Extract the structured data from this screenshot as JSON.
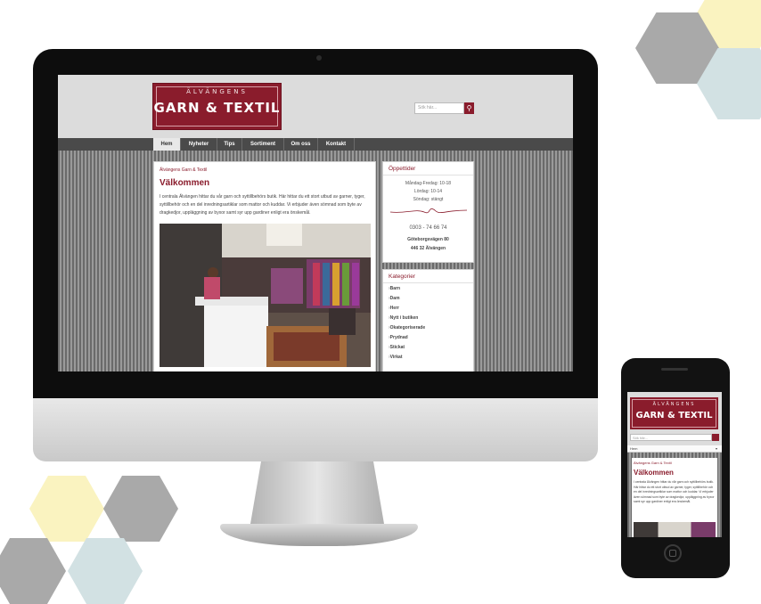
{
  "colors": {
    "brand": "#8a1c2c",
    "hex_yellow": "#faf3c0",
    "hex_blue": "#d2e1e3",
    "hex_gray": "#a9a9a9"
  },
  "apple_logo_glyph": "",
  "site": {
    "logo": {
      "small": "ÄLVÄNGENS",
      "big": "GARN & TEXTIL"
    },
    "search": {
      "placeholder": "Sök här...",
      "icon": "search-icon"
    },
    "nav": [
      "Hem",
      "Nyheter",
      "Tips",
      "Sortiment",
      "Om oss",
      "Kontakt"
    ],
    "nav_active": "Hem",
    "breadcrumb": "Älvängens Garn & Textil",
    "heading": "Välkommen",
    "intro": "I centrala Älvängen hittar du vår garn och syttillbehörs butik. Här hittar du ett stort utbud av garner, tyger, syttillbehör och en del inredningsartiklar som mattor och kuddar. Vi erbjuder även sömnad som byte av dragkedjor, uppläggning av byxor samt syr upp gardiner enligt era önskemål.",
    "hours": {
      "title": "Öppettider",
      "lines": [
        "Måndag-Fredag: 10-18",
        "Lördag: 10-14",
        "Söndag: stängt"
      ],
      "phone": "0303 - 74 66 74",
      "address": [
        "Göteborgsvägen 80",
        "446 32 Älvängen"
      ]
    },
    "categories": {
      "title": "Kategorier",
      "items": [
        "Barn",
        "Dam",
        "Herr",
        "Nytt i butiken",
        "Okategoriserade",
        "Prydnad",
        "Stickat",
        "Virkat"
      ]
    }
  },
  "mobile": {
    "logo": {
      "small": "ÄLVÄNGENS",
      "big": "GARN & TEXTIL"
    },
    "search": {
      "placeholder": "Sök här..."
    },
    "menu_label": "Hem",
    "breadcrumb": "Älvängens Garn & Textil",
    "heading": "Välkommen",
    "intro": "I centrala Älvängen hittar du vår garn och syttillbehörs butik. Här hittar du ett stort utbud av garner, tyger, syttillbehör och en del inredningsartiklar som mattor och kuddar. Vi erbjuder även sömnad som byte av dragkedjor, uppläggning av byxor samt syr upp gardiner enligt era önskemål."
  }
}
